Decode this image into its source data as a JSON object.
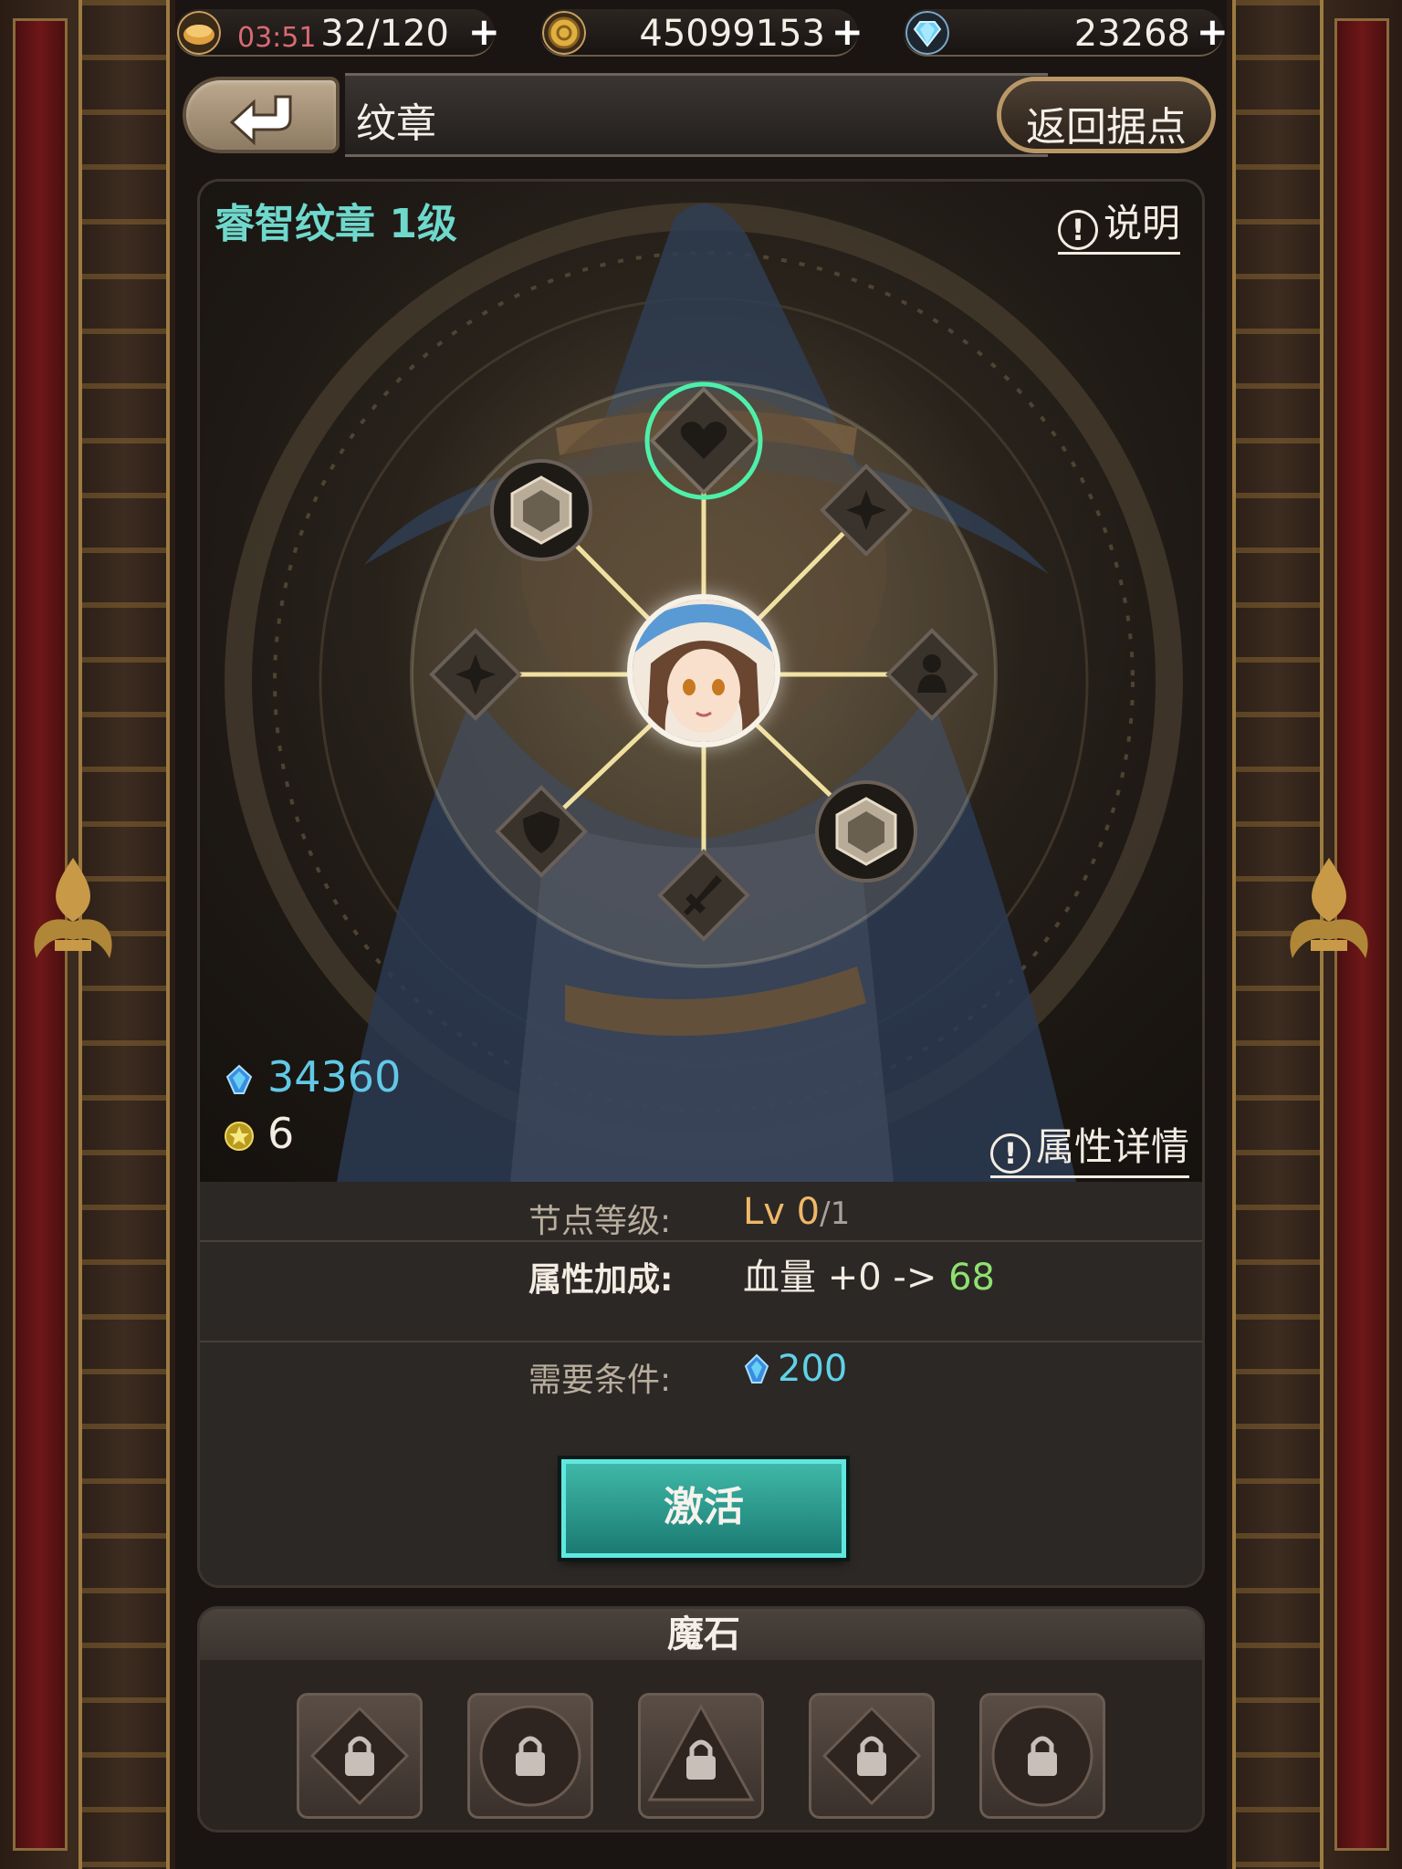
{
  "resources": {
    "stamina_timer": "03:51",
    "stamina": "32/120",
    "gold": "45099153",
    "gems": "23268",
    "plus_label": "+"
  },
  "header": {
    "title": "纹章",
    "return_label": "返回据点"
  },
  "emblem": {
    "name": "睿智纹章 1级",
    "explain_label": "说明",
    "detail_label": "属性详情",
    "crystal_count": "34360",
    "medal_count": "6"
  },
  "node_info": {
    "level_label": "节点等级:",
    "level_value": "Lv 0",
    "level_max": "/1",
    "attr_label": "属性加成:",
    "attr_value": "血量 +0 ->",
    "attr_gain": "68",
    "req_label": "需要条件:",
    "req_value": "200",
    "activate_label": "激活"
  },
  "magic_stones": {
    "title": "魔石",
    "slots": [
      {
        "shape": "diamond",
        "locked": true
      },
      {
        "shape": "circle",
        "locked": true
      },
      {
        "shape": "triangle",
        "locked": true
      },
      {
        "shape": "diamond",
        "locked": true
      },
      {
        "shape": "circle",
        "locked": true
      }
    ]
  },
  "colors": {
    "accent_teal": "#6fd8cc",
    "crystal_blue": "#62c8e6",
    "gain_green": "#8fe070",
    "level_orange": "#f0b868",
    "node_line": "#f0e0a0"
  },
  "icons": {
    "stamina": "bread-icon",
    "gold": "gold-coin-icon",
    "gem": "diamond-icon",
    "back": "back-arrow-icon",
    "crystal": "crystal-icon",
    "medal": "medal-icon",
    "lock": "lock-icon"
  }
}
